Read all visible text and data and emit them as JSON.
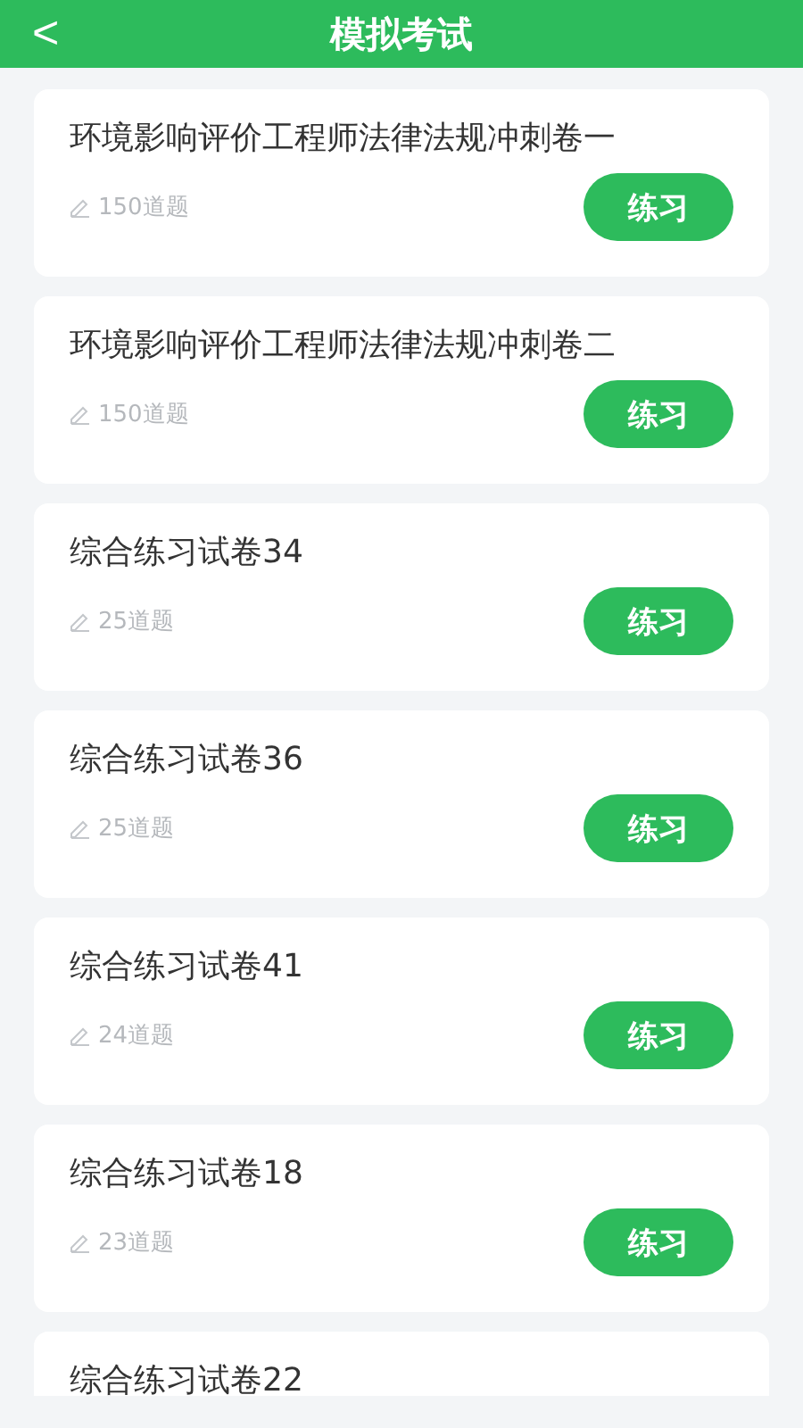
{
  "header": {
    "back": "<",
    "title": "模拟考试"
  },
  "papers": [
    {
      "title": "环境影响评价工程师法律法规冲刺卷一",
      "count": "150道题",
      "action": "练习"
    },
    {
      "title": "环境影响评价工程师法律法规冲刺卷二",
      "count": "150道题",
      "action": "练习"
    },
    {
      "title": "综合练习试卷34",
      "count": "25道题",
      "action": "练习"
    },
    {
      "title": "综合练习试卷36",
      "count": "25道题",
      "action": "练习"
    },
    {
      "title": "综合练习试卷41",
      "count": "24道题",
      "action": "练习"
    },
    {
      "title": "综合练习试卷18",
      "count": "23道题",
      "action": "练习"
    },
    {
      "title": "综合练习试卷22"
    }
  ]
}
